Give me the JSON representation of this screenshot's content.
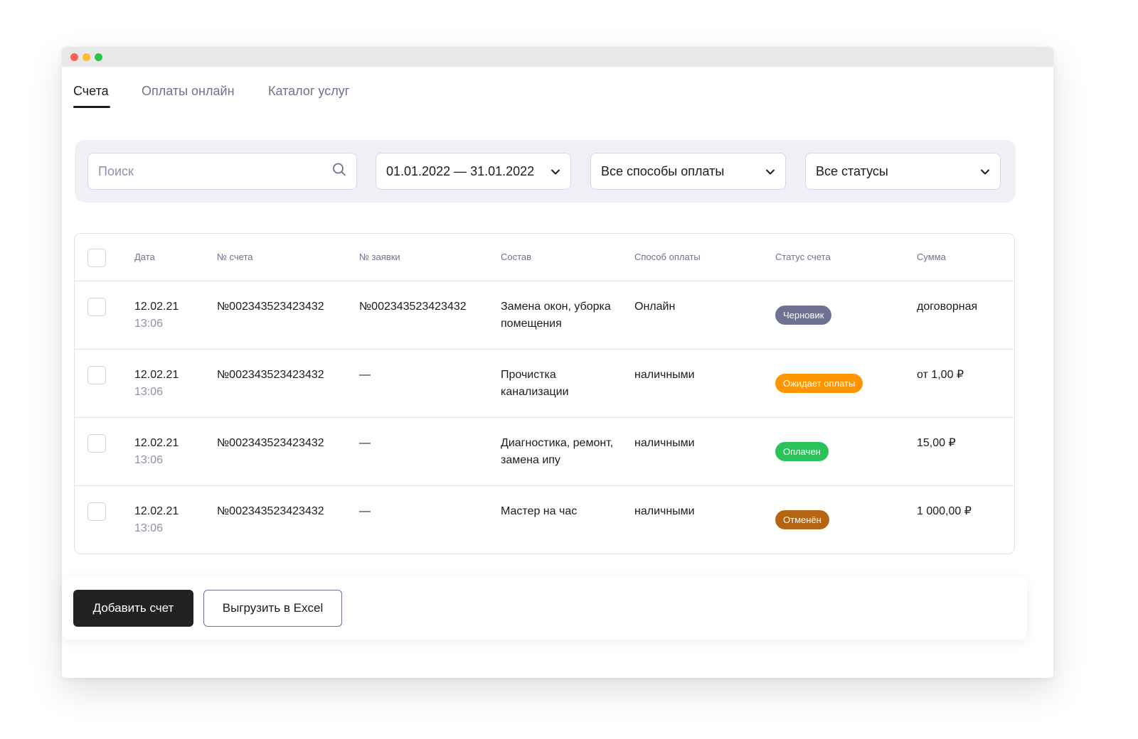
{
  "tabs": [
    {
      "label": "Счета"
    },
    {
      "label": "Оплаты онлайн"
    },
    {
      "label": "Каталог услуг"
    }
  ],
  "filters": {
    "search_placeholder": "Поиск",
    "date_range": "01.01.2022 — 31.01.2022",
    "payment_method": "Все способы оплаты",
    "status": "Все статусы"
  },
  "table": {
    "headers": {
      "date": "Дата",
      "invoice_no": "№ счета",
      "request_no": "№ заявки",
      "composition": "Состав",
      "payment_method": "Способ оплаты",
      "status": "Статус счета",
      "amount": "Сумма"
    },
    "rows": [
      {
        "date": "12.02.21",
        "time": "13:06",
        "invoice_no": "№002343523423432",
        "request_no": "№002343523423432",
        "composition": "Замена окон, уборка помещения",
        "payment_method": "Онлайн",
        "status": "Черновик",
        "status_color": "#6e7191",
        "amount": "договорная"
      },
      {
        "date": "12.02.21",
        "time": "13:06",
        "invoice_no": "№002343523423432",
        "request_no": "—",
        "composition": "Прочистка канализации",
        "payment_method": "наличными",
        "status": "Ожидает оплаты",
        "status_color": "#ff9500",
        "amount": "от 1,00 ₽"
      },
      {
        "date": "12.02.21",
        "time": "13:06",
        "invoice_no": "№002343523423432",
        "request_no": "—",
        "composition": "Диагностика, ремонт, замена ипу",
        "payment_method": "наличными",
        "status": "Оплачен",
        "status_color": "#2ac35a",
        "amount": "15,00 ₽"
      },
      {
        "date": "12.02.21",
        "time": "13:06",
        "invoice_no": "№002343523423432",
        "request_no": "—",
        "composition": "Мастер на час",
        "payment_method": "наличными",
        "status": "Отменён",
        "status_color": "#b5650f",
        "amount": "1 000,00 ₽"
      }
    ]
  },
  "actions": {
    "add_invoice": "Добавить счет",
    "export_excel": "Выгрузить в Excel"
  },
  "icons": {
    "search": "search-icon",
    "chevron": "chevron-down-icon"
  }
}
